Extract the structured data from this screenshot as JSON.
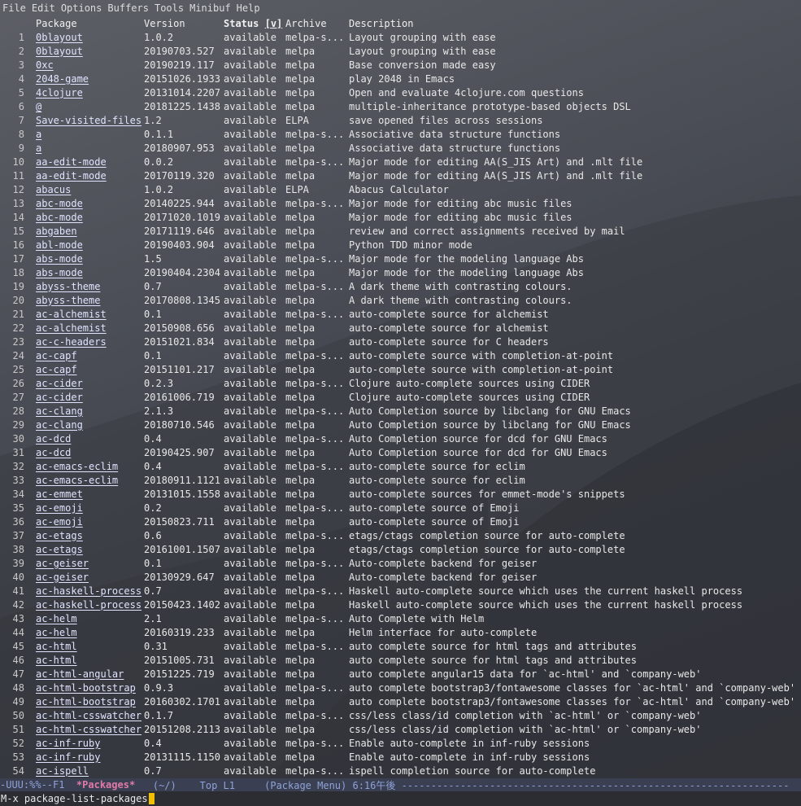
{
  "menu": [
    "File",
    "Edit",
    "Options",
    "Buffers",
    "Tools",
    "Minibuf",
    "Help"
  ],
  "columns": {
    "package": "Package",
    "version": "Version",
    "status": "Status",
    "status_sort": "[v]",
    "archive": "Archive",
    "description": "Description"
  },
  "rows": [
    [
      "1",
      "0blayout",
      "1.0.2",
      "available",
      "melpa-s...",
      "Layout grouping with ease"
    ],
    [
      "2",
      "0blayout",
      "20190703.527",
      "available",
      "melpa",
      "Layout grouping with ease"
    ],
    [
      "3",
      "0xc",
      "20190219.117",
      "available",
      "melpa",
      "Base conversion made easy"
    ],
    [
      "4",
      "2048-game",
      "20151026.1933",
      "available",
      "melpa",
      "play 2048 in Emacs"
    ],
    [
      "5",
      "4clojure",
      "20131014.2207",
      "available",
      "melpa",
      "Open and evaluate 4clojure.com questions"
    ],
    [
      "6",
      "@",
      "20181225.1438",
      "available",
      "melpa",
      "multiple-inheritance prototype-based objects DSL"
    ],
    [
      "7",
      "Save-visited-files",
      "1.2",
      "available",
      "ELPA",
      "save opened files across sessions"
    ],
    [
      "8",
      "a",
      "0.1.1",
      "available",
      "melpa-s...",
      "Associative data structure functions"
    ],
    [
      "9",
      "a",
      "20180907.953",
      "available",
      "melpa",
      "Associative data structure functions"
    ],
    [
      "10",
      "aa-edit-mode",
      "0.0.2",
      "available",
      "melpa-s...",
      "Major mode for editing AA(S_JIS Art) and .mlt file"
    ],
    [
      "11",
      "aa-edit-mode",
      "20170119.320",
      "available",
      "melpa",
      "Major mode for editing AA(S_JIS Art) and .mlt file"
    ],
    [
      "12",
      "abacus",
      "1.0.2",
      "available",
      "ELPA",
      "Abacus Calculator"
    ],
    [
      "13",
      "abc-mode",
      "20140225.944",
      "available",
      "melpa-s...",
      "Major mode for editing abc music files"
    ],
    [
      "14",
      "abc-mode",
      "20171020.1019",
      "available",
      "melpa",
      "Major mode for editing abc music files"
    ],
    [
      "15",
      "abgaben",
      "20171119.646",
      "available",
      "melpa",
      "review and correct assignments received by mail"
    ],
    [
      "16",
      "abl-mode",
      "20190403.904",
      "available",
      "melpa",
      "Python TDD minor mode"
    ],
    [
      "17",
      "abs-mode",
      "1.5",
      "available",
      "melpa-s...",
      "Major mode for the modeling language Abs"
    ],
    [
      "18",
      "abs-mode",
      "20190404.2304",
      "available",
      "melpa",
      "Major mode for the modeling language Abs"
    ],
    [
      "19",
      "abyss-theme",
      "0.7",
      "available",
      "melpa-s...",
      "A dark theme with contrasting colours."
    ],
    [
      "20",
      "abyss-theme",
      "20170808.1345",
      "available",
      "melpa",
      "A dark theme with contrasting colours."
    ],
    [
      "21",
      "ac-alchemist",
      "0.1",
      "available",
      "melpa-s...",
      "auto-complete source for alchemist"
    ],
    [
      "22",
      "ac-alchemist",
      "20150908.656",
      "available",
      "melpa",
      "auto-complete source for alchemist"
    ],
    [
      "23",
      "ac-c-headers",
      "20151021.834",
      "available",
      "melpa",
      "auto-complete source for C headers"
    ],
    [
      "24",
      "ac-capf",
      "0.1",
      "available",
      "melpa-s...",
      "auto-complete source with completion-at-point"
    ],
    [
      "25",
      "ac-capf",
      "20151101.217",
      "available",
      "melpa",
      "auto-complete source with completion-at-point"
    ],
    [
      "26",
      "ac-cider",
      "0.2.3",
      "available",
      "melpa-s...",
      "Clojure auto-complete sources using CIDER"
    ],
    [
      "27",
      "ac-cider",
      "20161006.719",
      "available",
      "melpa",
      "Clojure auto-complete sources using CIDER"
    ],
    [
      "28",
      "ac-clang",
      "2.1.3",
      "available",
      "melpa-s...",
      "Auto Completion source by libclang for GNU Emacs"
    ],
    [
      "29",
      "ac-clang",
      "20180710.546",
      "available",
      "melpa",
      "Auto Completion source by libclang for GNU Emacs"
    ],
    [
      "30",
      "ac-dcd",
      "0.4",
      "available",
      "melpa-s...",
      "Auto Completion source for dcd for GNU Emacs"
    ],
    [
      "31",
      "ac-dcd",
      "20190425.907",
      "available",
      "melpa",
      "Auto Completion source for dcd for GNU Emacs"
    ],
    [
      "32",
      "ac-emacs-eclim",
      "0.4",
      "available",
      "melpa-s...",
      "auto-complete source for eclim"
    ],
    [
      "33",
      "ac-emacs-eclim",
      "20180911.1121",
      "available",
      "melpa",
      "auto-complete source for eclim"
    ],
    [
      "34",
      "ac-emmet",
      "20131015.1558",
      "available",
      "melpa",
      "auto-complete sources for emmet-mode's snippets"
    ],
    [
      "35",
      "ac-emoji",
      "0.2",
      "available",
      "melpa-s...",
      "auto-complete source of Emoji"
    ],
    [
      "36",
      "ac-emoji",
      "20150823.711",
      "available",
      "melpa",
      "auto-complete source of Emoji"
    ],
    [
      "37",
      "ac-etags",
      "0.6",
      "available",
      "melpa-s...",
      "etags/ctags completion source for auto-complete"
    ],
    [
      "38",
      "ac-etags",
      "20161001.1507",
      "available",
      "melpa",
      "etags/ctags completion source for auto-complete"
    ],
    [
      "39",
      "ac-geiser",
      "0.1",
      "available",
      "melpa-s...",
      "Auto-complete backend for geiser"
    ],
    [
      "40",
      "ac-geiser",
      "20130929.647",
      "available",
      "melpa",
      "Auto-complete backend for geiser"
    ],
    [
      "41",
      "ac-haskell-process",
      "0.7",
      "available",
      "melpa-s...",
      "Haskell auto-complete source which uses the current haskell process"
    ],
    [
      "42",
      "ac-haskell-process",
      "20150423.1402",
      "available",
      "melpa",
      "Haskell auto-complete source which uses the current haskell process"
    ],
    [
      "43",
      "ac-helm",
      "2.1",
      "available",
      "melpa-s...",
      "Auto Complete with Helm"
    ],
    [
      "44",
      "ac-helm",
      "20160319.233",
      "available",
      "melpa",
      "Helm interface for auto-complete"
    ],
    [
      "45",
      "ac-html",
      "0.31",
      "available",
      "melpa-s...",
      "auto complete source for html tags and attributes"
    ],
    [
      "46",
      "ac-html",
      "20151005.731",
      "available",
      "melpa",
      "auto complete source for html tags and attributes"
    ],
    [
      "47",
      "ac-html-angular",
      "20151225.719",
      "available",
      "melpa",
      "auto complete angular15 data for `ac-html' and `company-web'"
    ],
    [
      "48",
      "ac-html-bootstrap",
      "0.9.3",
      "available",
      "melpa-s...",
      "auto complete bootstrap3/fontawesome classes for `ac-html' and `company-web'"
    ],
    [
      "49",
      "ac-html-bootstrap",
      "20160302.1701",
      "available",
      "melpa",
      "auto complete bootstrap3/fontawesome classes for `ac-html' and `company-web'"
    ],
    [
      "50",
      "ac-html-csswatcher",
      "0.1.7",
      "available",
      "melpa-s...",
      "css/less class/id completion with `ac-html' or `company-web'"
    ],
    [
      "51",
      "ac-html-csswatcher",
      "20151208.2113",
      "available",
      "melpa",
      "css/less class/id completion with `ac-html' or `company-web'"
    ],
    [
      "52",
      "ac-inf-ruby",
      "0.4",
      "available",
      "melpa-s...",
      "Enable auto-complete in inf-ruby sessions"
    ],
    [
      "53",
      "ac-inf-ruby",
      "20131115.1150",
      "available",
      "melpa",
      "Enable auto-complete in inf-ruby sessions"
    ],
    [
      "54",
      "ac-ispell",
      "0.7",
      "available",
      "melpa-s...",
      "ispell completion source for auto-complete"
    ]
  ],
  "modeline": {
    "left": "-UUU:%%--F1  ",
    "buffer": "*Packages*",
    "rest": "   (~/)    Top L1     (Package Menu) 6:16午後 ------------------------------------------------------------------"
  },
  "minibuffer": {
    "text": "M-x package-list-packages"
  },
  "colors": {
    "link": "#e0e4ff",
    "modeline_bg": "#3a3f52",
    "buffer_name": "#e07aa8",
    "cursor": "#f0c000"
  }
}
